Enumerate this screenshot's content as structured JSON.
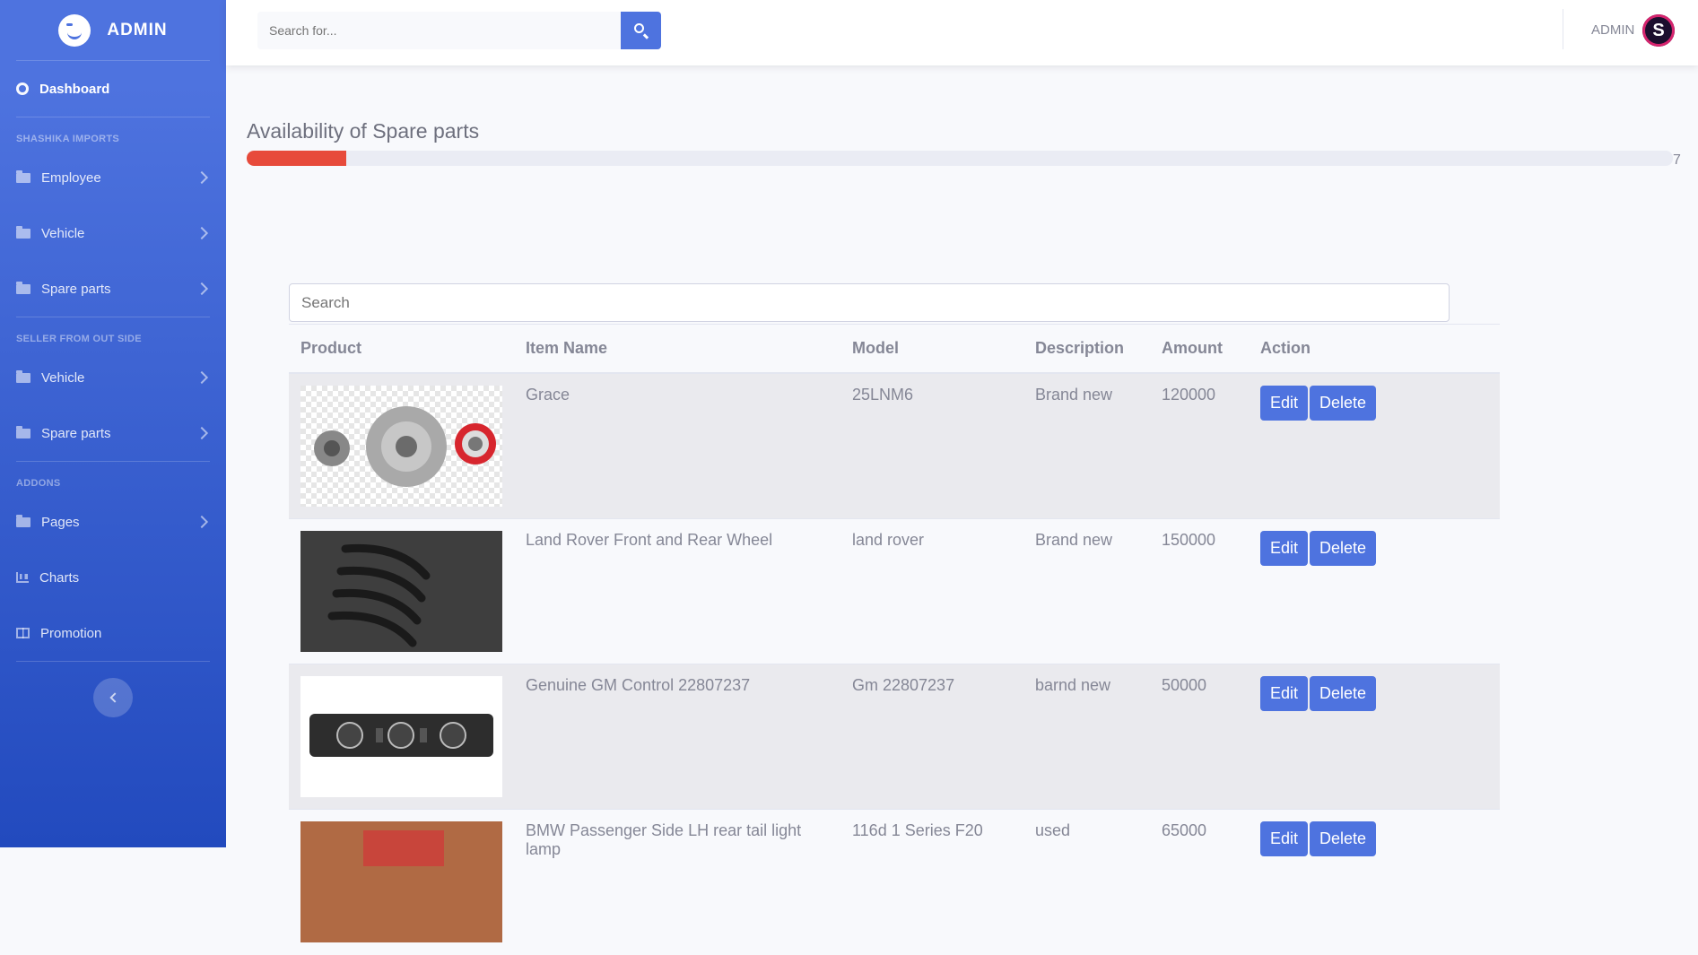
{
  "brand": {
    "name": "ADMIN"
  },
  "sidebar": {
    "dashboard": "Dashboard",
    "sections": [
      {
        "heading": "SHASHIKA IMPORTS",
        "items": [
          "Employee",
          "Vehicle",
          "Spare parts"
        ]
      },
      {
        "heading": "SELLER FROM OUT SIDE",
        "items": [
          "Vehicle",
          "Spare parts"
        ]
      },
      {
        "heading": "ADDONS",
        "items": [
          "Pages",
          "Charts",
          "Promotion"
        ]
      }
    ]
  },
  "topbar": {
    "search_placeholder": "Search for...",
    "user_name": "ADMIN",
    "avatar_letter": "S"
  },
  "availability": {
    "title": "Availability of Spare parts",
    "value": 7,
    "percent": 7
  },
  "table": {
    "search_placeholder": "Search",
    "headers": [
      "Product",
      "Item Name",
      "Model",
      "Description",
      "Amount",
      "Action"
    ],
    "rows": [
      {
        "item_name": "Grace",
        "model": "25LNM6",
        "description": "Brand new",
        "amount": "120000",
        "edit": "Edit",
        "delete": "Delete",
        "image": "alternator-parts"
      },
      {
        "item_name": "Land Rover Front and Rear Wheel",
        "model": "land rover",
        "description": "Brand new",
        "amount": "150000",
        "edit": "Edit",
        "delete": "Delete",
        "image": "wheel-arches"
      },
      {
        "item_name": "Genuine GM Control 22807237",
        "model": "Gm 22807237",
        "description": "barnd new",
        "amount": "50000",
        "edit": "Edit",
        "delete": "Delete",
        "image": "climate-control-panel"
      },
      {
        "item_name": "BMW Passenger Side LH rear tail light lamp",
        "model": "116d 1 Series F20",
        "description": "used",
        "amount": "65000",
        "edit": "Edit",
        "delete": "Delete",
        "image": "tail-light"
      }
    ]
  },
  "colors": {
    "primary": "#4e73df",
    "danger": "#e74a3b",
    "sidebar_dark": "#224abe"
  }
}
